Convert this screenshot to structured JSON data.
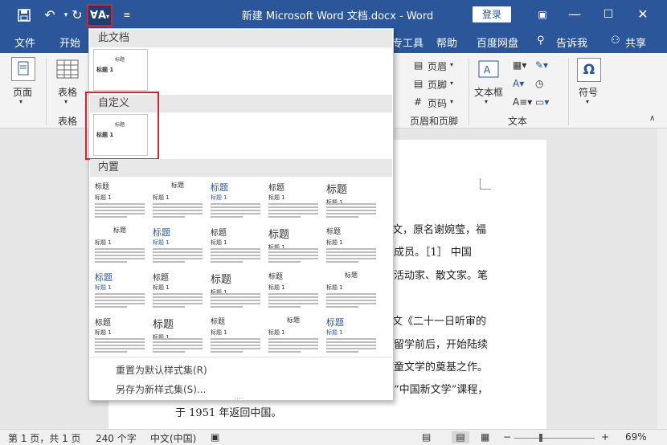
{
  "titlebar": {
    "title": "新建 Microsoft Word 文档.docx - Word",
    "login": "登录",
    "icons": [
      "save-icon",
      "undo-icon",
      "redo-icon",
      "style-set-icon",
      "customize-qat-icon"
    ]
  },
  "tabs": {
    "file": "文件",
    "home": "开始",
    "tools_partial": "专工具",
    "help": "帮助",
    "baidu": "百度网盘",
    "tell": "告诉我",
    "share": "共享"
  },
  "ribbon": {
    "page": "页面",
    "table": "表格",
    "table_group": "表格",
    "header": "页眉",
    "footer": "页脚",
    "page_number": "页码",
    "header_footer_group": "页眉和页脚",
    "textbox": "文本框",
    "text_group": "文本",
    "symbol": "符号"
  },
  "dropdown": {
    "this_doc": "此文档",
    "custom": "自定义",
    "builtin": "内置",
    "thumb_title": "标题",
    "thumb_sub": "标题 1",
    "reset": "重置为默认样式集(R)",
    "save_as": "另存为新样式集(S)...",
    "thumbs": [
      "标题",
      "标题",
      "标题",
      "标题",
      "标题",
      "标题",
      "标题",
      "标题",
      "标题",
      "标题",
      "标题",
      "标题",
      "标题",
      "标题",
      "标题",
      "标题",
      "标题",
      "标题",
      "标题",
      "标题",
      "标题",
      "标题"
    ]
  },
  "document": {
    "line1": "文，原名谢婉莹，福",
    "line2": "成员。［1］ 中国",
    "line3": "活动家、散文家。笔",
    "line4": "文《二十一日听审的",
    "line5": "留学前后，开始陆续",
    "line6": "童文学的奠基之作。",
    "line7": "“中国新文学”课程，",
    "line8": "于 1951 年返回中国。"
  },
  "status": {
    "page": "第 1 页，共 1 页",
    "words": "240 个字",
    "lang": "中文(中国)",
    "zoom": "69%"
  },
  "colors": {
    "accent": "#2b579a",
    "highlight": "#d9232d"
  }
}
